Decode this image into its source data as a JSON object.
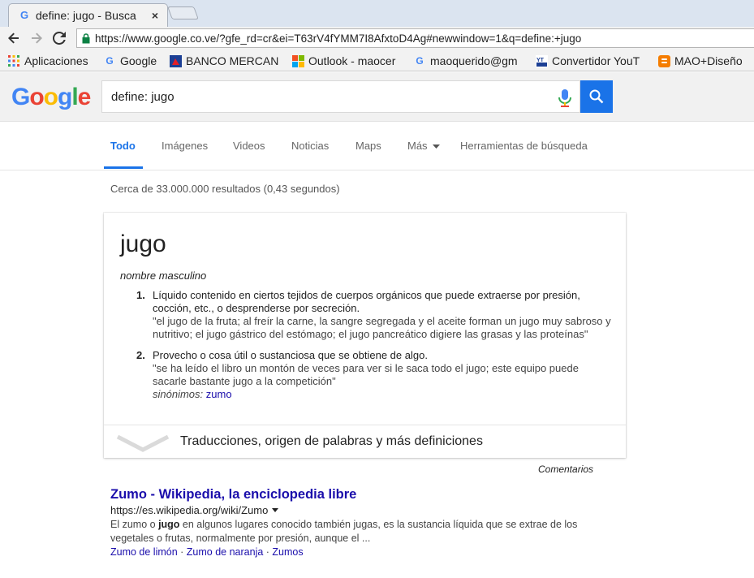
{
  "browser": {
    "tab_title": "define: jugo - Busca",
    "tab_close": "×",
    "url": "https://www.google.co.ve/?gfe_rd=cr&ei=T63rV4fYMM7I8AfxtoD4Ag#newwindow=1&q=define:+jugo",
    "bookmarks": [
      {
        "label": "Aplicaciones",
        "icon": "apps-grid-icon"
      },
      {
        "label": "Google",
        "icon": "google-g-icon"
      },
      {
        "label": "BANCO MERCAN",
        "icon": "banco-mercantil-icon"
      },
      {
        "label": "Outlook - maocer",
        "icon": "outlook-icon"
      },
      {
        "label": "maoquerido@gm",
        "icon": "google-g-icon"
      },
      {
        "label": "Convertidor YouT",
        "icon": "yt-mp3-icon"
      },
      {
        "label": "MAO+Diseño",
        "icon": "blogger-icon"
      }
    ]
  },
  "google": {
    "logo_letters": [
      "G",
      "o",
      "o",
      "g",
      "l",
      "e"
    ],
    "logo_colors": [
      "#4285f4",
      "#ea4335",
      "#fbbc05",
      "#4285f4",
      "#34a853",
      "#ea4335"
    ],
    "query": "define: jugo",
    "tabs": [
      "Todo",
      "Imágenes",
      "Videos",
      "Noticias",
      "Maps",
      "Más",
      "Herramientas de búsqueda"
    ]
  },
  "results": {
    "stats": "Cerca de 33.000.000 resultados (0,43 segundos)",
    "dictionary": {
      "word": "jugo",
      "pos": "nombre masculino",
      "senses": [
        {
          "num": "1.",
          "def": "Líquido contenido en ciertos tejidos de cuerpos orgánicos que puede extraerse por presión, cocción, etc., o desprenderse por secreción.",
          "example": "\"el jugo de la fruta; al freír la carne, la sangre segregada y el aceite forman un jugo muy sabroso y nutritivo; el jugo gástrico del estómago; el jugo pancreático digiere las grasas y las proteínas\""
        },
        {
          "num": "2.",
          "def": "Provecho o cosa útil o sustanciosa que se obtiene de algo.",
          "example": "\"se ha leído el libro un montón de veces para ver si le saca todo el jugo; este equipo puede sacarle bastante jugo a la competición\"",
          "synonyms_label": "sinónimos:",
          "synonym": "zumo"
        }
      ],
      "more": "Traducciones, origen de palabras y más definiciones"
    },
    "comments": "Comentarios",
    "items": [
      {
        "title": "Zumo - Wikipedia, la enciclopedia libre",
        "url": "https://es.wikipedia.org/wiki/Zumo",
        "snippet_pre": "El zumo o ",
        "snippet_bold": "jugo",
        "snippet_post": " en algunos lugares conocido también jugas, es la sustancia líquida que se extrae de los vegetales o frutas, normalmente por presión, aunque el ...",
        "links": [
          "Zumo de limón",
          "Zumo de naranja",
          "Zumos"
        ],
        "link_sep": " · "
      }
    ]
  },
  "colors": {
    "accent": "#1a73e8",
    "link": "#1a0dab"
  }
}
